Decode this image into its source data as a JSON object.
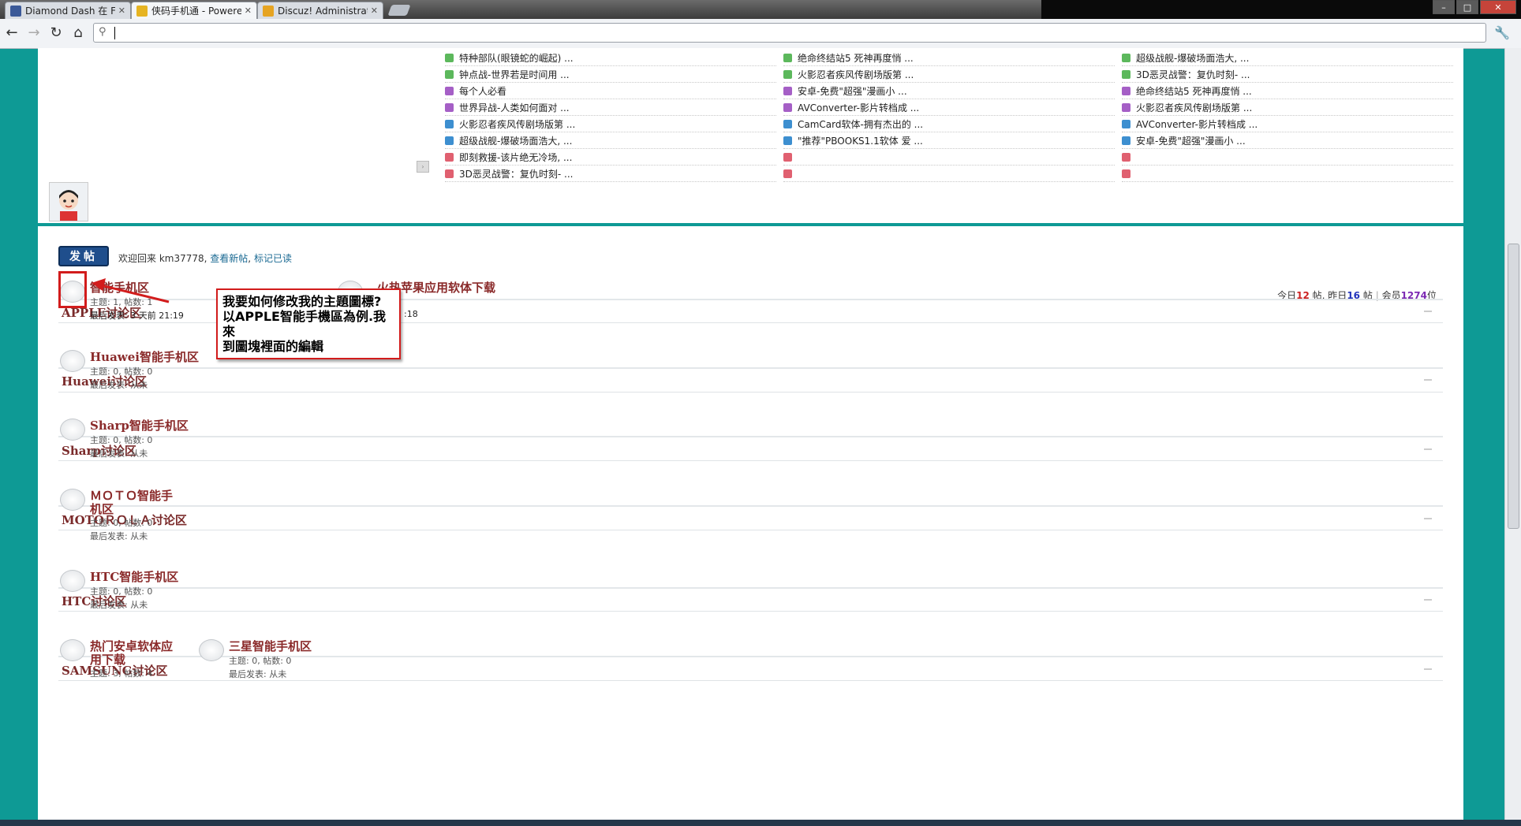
{
  "browser": {
    "tabs": [
      {
        "title": "Diamond Dash 在 Facebo",
        "favicon_color": "#3b5998",
        "active": false
      },
      {
        "title": "侠码手机通 - Powered by D",
        "favicon_color": "#e6b422",
        "active": true
      },
      {
        "title": "Discuz! Administrator's Co",
        "favicon_color": "#e6a422",
        "active": false
      }
    ],
    "address_value": "",
    "window_controls": {
      "minimize": "–",
      "maximize": "□",
      "close": "✕"
    }
  },
  "hot_topics": {
    "col1": [
      {
        "icon": "g",
        "text": "特种部队(眼镜蛇的崛起) ..."
      },
      {
        "icon": "g",
        "text": "钟点战-世界若是时间用 ..."
      },
      {
        "icon": "p",
        "text": "每个人必看"
      },
      {
        "icon": "p",
        "text": "世界异战-人类如何面对 ..."
      },
      {
        "icon": "b",
        "text": "火影忍者疾风传剧场版第 ..."
      },
      {
        "icon": "b",
        "text": "超级战舰-爆破场面浩大, ..."
      },
      {
        "icon": "r",
        "text": "即刻救援-该片绝无冷场, ..."
      },
      {
        "icon": "r",
        "text": "3D恶灵战警：复仇时刻- ..."
      }
    ],
    "col2": [
      {
        "icon": "g",
        "text": "绝命终结站5 死神再度悄 ..."
      },
      {
        "icon": "g",
        "text": "火影忍者疾风传剧场版第 ..."
      },
      {
        "icon": "p",
        "text": "安卓-免费\"超强\"漫画小 ..."
      },
      {
        "icon": "p",
        "text": "AVConverter-影片转档成 ..."
      },
      {
        "icon": "b",
        "text": "CamCard软体-拥有杰出的 ..."
      },
      {
        "icon": "b",
        "text": "\"推荐\"PBOOKS1.1软体 爱 ..."
      },
      {
        "icon": "r",
        "text": ""
      },
      {
        "icon": "r",
        "text": ""
      }
    ],
    "col3": [
      {
        "icon": "g",
        "text": "超级战舰-爆破场面浩大, ..."
      },
      {
        "icon": "g",
        "text": "3D恶灵战警：复仇时刻- ..."
      },
      {
        "icon": "p",
        "text": "绝命终结站5 死神再度悄 ..."
      },
      {
        "icon": "p",
        "text": "火影忍者疾风传剧场版第 ..."
      },
      {
        "icon": "b",
        "text": "AVConverter-影片转档成 ..."
      },
      {
        "icon": "b",
        "text": "安卓-免费\"超强\"漫画小 ..."
      },
      {
        "icon": "r",
        "text": ""
      },
      {
        "icon": "r",
        "text": ""
      }
    ]
  },
  "post_button": "发帖",
  "welcome": {
    "prefix": "欢迎回来 km37778,",
    "new_posts": "查看新帖",
    "sep": ",",
    "mark_read": "标记已读"
  },
  "stats": {
    "today_label": "今日",
    "today": "12",
    "today_unit": "帖, 昨日",
    "yesterday": "16",
    "yesterday_unit": "帖",
    "sep": "|",
    "members_label": "会员",
    "members": "1274",
    "members_unit": "位"
  },
  "categories": [
    {
      "name": "APPLE讨论区",
      "forums": [
        {
          "name": "智能手机区",
          "meta1": "主题: 1, 帖数: 1",
          "meta2": "最后发表: 3 天前 21:19"
        },
        {
          "name": "火热苹果应用软体下载",
          "meta1": "",
          "meta2": ":18"
        }
      ]
    },
    {
      "name": "Huawei讨论区",
      "forums": [
        {
          "name": "Huawei智能手机区",
          "meta1": "主题: 0, 帖数: 0",
          "meta2": "最后发表: 从未"
        }
      ]
    },
    {
      "name": "Sharp讨论区",
      "forums": [
        {
          "name": "Sharp智能手机区",
          "meta1": "主题: 0, 帖数: 0",
          "meta2": "最后发表: 从未"
        }
      ]
    },
    {
      "name": "MOTOＲＯＬＡ讨论区",
      "forums": [
        {
          "name_line1": "ＭＯＴＯ智能手",
          "name_line2": "机区",
          "meta1": "主题: 0, 帖数: 0",
          "meta2": "最后发表: 从未"
        }
      ]
    },
    {
      "name": "HTC讨论区",
      "forums": [
        {
          "name": "HTC智能手机区",
          "meta1": "主题: 0, 帖数: 0",
          "meta2": "最后发表: 从未"
        }
      ]
    },
    {
      "name": "SAMSUNG讨论区",
      "forums": [
        {
          "name_line1": "热门安卓软体应",
          "name_line2": "用下载",
          "meta1": "主题: 3, 帖数: 4"
        },
        {
          "name": "三星智能手机区",
          "meta1": "主题: 0, 帖数: 0",
          "meta2": "最后发表: 从未"
        }
      ]
    }
  ],
  "annotation": {
    "line1": "我要如何修改我的主題圖標?",
    "line2": "以APPLE智能手機區為例.我來",
    "line3": "到圖塊裡面的編輯",
    "color": "#d21c1c"
  }
}
